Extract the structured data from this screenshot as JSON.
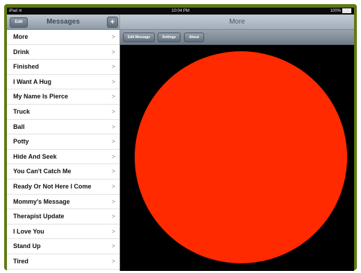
{
  "status_bar": {
    "device": "iPad",
    "wifi_icon": "wifi-icon",
    "time": "10:04 PM",
    "battery": "100%"
  },
  "sidebar": {
    "title": "Messages",
    "edit_label": "Edit",
    "add_label": "+",
    "items": [
      "More",
      "Drink",
      "Finished",
      "I Want A Hug",
      "My Name Is Pierce",
      "Truck",
      "Ball",
      "Potty",
      "Hide And Seek",
      "You Can't Catch Me",
      "Ready Or Not Here I Come",
      "Mommy's Message",
      "Therapist Update",
      "I Love You",
      "Stand Up",
      "Tired"
    ],
    "chevron": ">"
  },
  "detail": {
    "title": "More",
    "toolbar": {
      "edit_message": "Edit Message",
      "settings": "Settings",
      "about": "About"
    },
    "circle_color": "#ff2a00"
  }
}
